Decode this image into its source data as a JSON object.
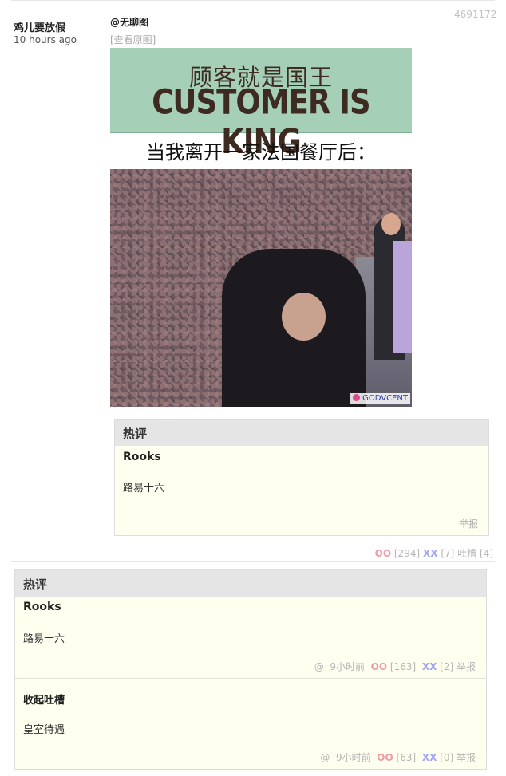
{
  "post": {
    "id": "4691172",
    "author": "鸡儿要放假",
    "time": "10 hours ago",
    "tag": "@无聊图",
    "view_original": "[查看原图]",
    "image": {
      "sign_cn": "顾客就是国王",
      "sign_en": "CUSTOMER IS KING",
      "caption": "当我离开一家法国餐厅后：",
      "watermark": "GODVCENT"
    },
    "hot_comment": {
      "header": "热评",
      "author": "Rooks",
      "text": "路易十六",
      "report": "举报"
    },
    "actions": {
      "oo_label": "OO",
      "oo_count": "[294]",
      "xx_label": "XX",
      "xx_count": "[7]",
      "tucao_label": "吐槽",
      "tucao_count": "[4]"
    }
  },
  "hot_section": {
    "header": "热评",
    "comments": [
      {
        "author": "Rooks",
        "text": "路易十六",
        "at": "@",
        "time": "9小时前",
        "oo_label": "OO",
        "oo_count": "[163]",
        "xx_label": "XX",
        "xx_count": "[2]",
        "report": "举报"
      },
      {
        "author": "收起吐槽",
        "text": "皇室待遇",
        "at": "@",
        "time": "9小时前",
        "oo_label": "OO",
        "oo_count": "[63]",
        "xx_label": "XX",
        "xx_count": "[0]",
        "report": "举报"
      }
    ]
  }
}
